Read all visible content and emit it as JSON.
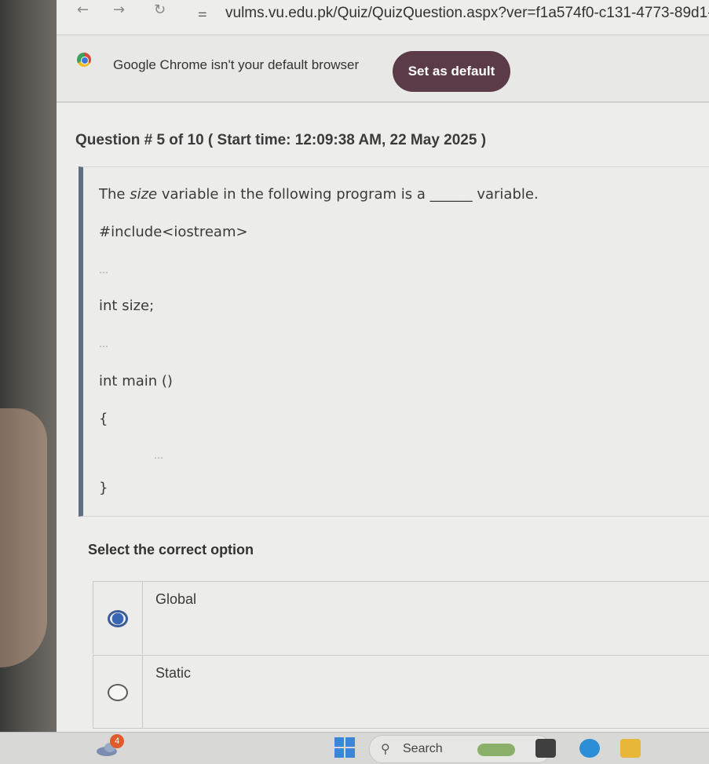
{
  "browser": {
    "url": "vulms.vu.edu.pk/Quiz/QuizQuestion.aspx?ver=f1a574f0-c131-4773-89d1-"
  },
  "infobar": {
    "message": "Google Chrome isn't your default browser",
    "button_label": "Set as default"
  },
  "question": {
    "header_prefix": "Question # 5 of 10 ( ",
    "start_time_label": "Start time: 12:09:38 AM, 22 May 2025",
    "header_suffix": " )",
    "prompt_pre": "The ",
    "prompt_italic": "size",
    "prompt_post": " variable in the following program is a ______ variable.",
    "code_include": "#include<iostream>",
    "code_decl": "int size;",
    "code_main": "int main ()",
    "code_open": "{",
    "code_close": "}"
  },
  "options": {
    "title": "Select the correct option",
    "items": [
      {
        "label": "Global",
        "selected": true
      },
      {
        "label": "Static",
        "selected": false
      }
    ]
  },
  "taskbar": {
    "weather_badge": "4",
    "search_label": "Search"
  },
  "colors": {
    "button_bg": "#5b3b48",
    "radio_selected": "#3a64b4",
    "question_border": "#5d6f80"
  }
}
